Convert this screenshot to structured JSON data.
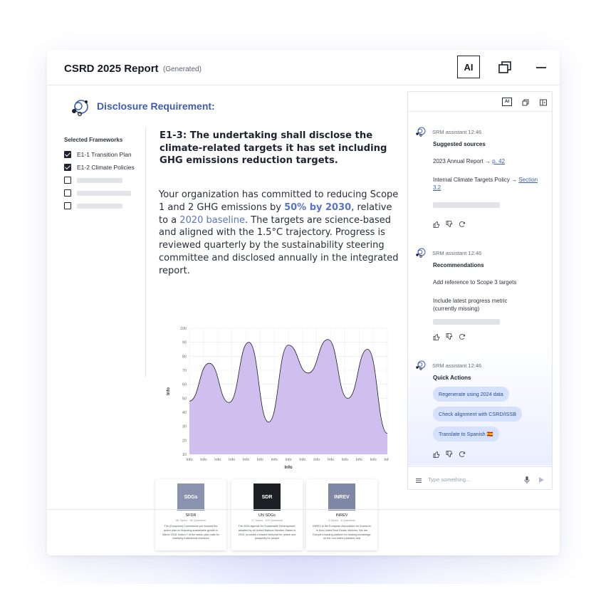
{
  "window": {
    "title": "CSRD 2025 Report",
    "subtitle": "(Generated)",
    "ai_label": "AI"
  },
  "disclosure": {
    "heading": "Disclosure Requirement:"
  },
  "frameworks": {
    "heading": "Selected Frameworks",
    "items": [
      {
        "label": "E1-1 Transition Plan",
        "checked": true
      },
      {
        "label": "E1-2 Climate Policies",
        "checked": true
      },
      {
        "label": "",
        "checked": false
      },
      {
        "label": "",
        "checked": false
      },
      {
        "label": "",
        "checked": false
      }
    ]
  },
  "requirement": {
    "heading": "E1-3: The undertaking shall disclose the climate-related targets it has set including GHG emissions reduction targets.",
    "body_1": "Your organization has committed to reducing Scope 1 and 2 GHG emissions by ",
    "body_hl1": "50% by 2030",
    "body_2": ", relative to a ",
    "body_hl2": "2020 baseline",
    "body_3": ". The targets are science-based and aligned with the 1.5°C trajectory. Progress is reviewed quarterly by the sustainability steering committee and disclosed annually in the integrated report."
  },
  "chart_data": {
    "type": "area",
    "x": [
      "Info",
      "Info",
      "Info",
      "Info",
      "Info",
      "Info",
      "Info",
      "Info",
      "Info",
      "Info",
      "Info",
      "Info",
      "Info",
      "Info",
      "Info"
    ],
    "series": [
      {
        "values": [
          48,
          75,
          47,
          90,
          33,
          88,
          68,
          92,
          50,
          85,
          25
        ]
      }
    ],
    "ylim": [
      10,
      100
    ],
    "yticks": [
      10,
      20,
      30,
      40,
      50,
      60,
      70,
      80,
      90,
      100
    ],
    "xlabel": "Info",
    "ylabel": "Info",
    "grid": true,
    "fill_color": "#cbb8ec",
    "line_color": "#1c1f27"
  },
  "cards": [
    {
      "image_label": "SDGs",
      "name": "SFDR",
      "meta": "86 Topics · 98 Questions",
      "desc": "The (European) Commission put forward the action plan on financing sustainable growth in March 2018. Action 7 of the action plan calls for clarifying institutional investors",
      "image_color": "#8a93ad"
    },
    {
      "image_label": "SDR",
      "name": "UN SDGs",
      "meta": "17 Topics · 109 Questions",
      "desc": "The 2030 Agenda for Sustainable Development, adopted by all United Nations Member States in 2015, provides a shared blueprint for peace and prosperity for people",
      "image_color": "#1d1f24"
    },
    {
      "image_label": "INREV",
      "name": "INREV",
      "meta": "4 Topics · 8 Questions",
      "desc": "INREV is the European Association for Investors in Non-Listed Real Estate Vehicles. We are Europe's leading platform for sharing knowledge on the non-listed (unlisted) real",
      "image_color": "#7e88a6"
    }
  ],
  "assistant": {
    "ai_label": "AI",
    "messages": [
      {
        "sender": "SRM assistant 12:46",
        "title": "Suggested sources",
        "lines": [
          {
            "text": "2023 Annual Report → ",
            "link": "p. 42"
          },
          {
            "text": "Internal Climate Targets Policy → ",
            "link": "Section 3.2"
          }
        ]
      },
      {
        "sender": "SRM assistant 12:46",
        "title": "Recommendations",
        "lines": [
          {
            "text": "Add reference to Scope 3 targets"
          },
          {
            "text": "Include latest progress metric (currently missing)"
          }
        ]
      },
      {
        "sender": "SRM assistant 12:46",
        "title": "Quick Actions",
        "actions": [
          "Regenerate using 2024 data",
          "Check alignment with CSRD/ISSB",
          "Translate to Spanish 🇪🇸"
        ]
      }
    ],
    "composer_placeholder": "Type something..."
  },
  "colors": {
    "accent": "#3e5db0",
    "highlight": "#5874c7",
    "chip_bg": "#d6e2fb",
    "chip_text": "#2b4d9c"
  }
}
